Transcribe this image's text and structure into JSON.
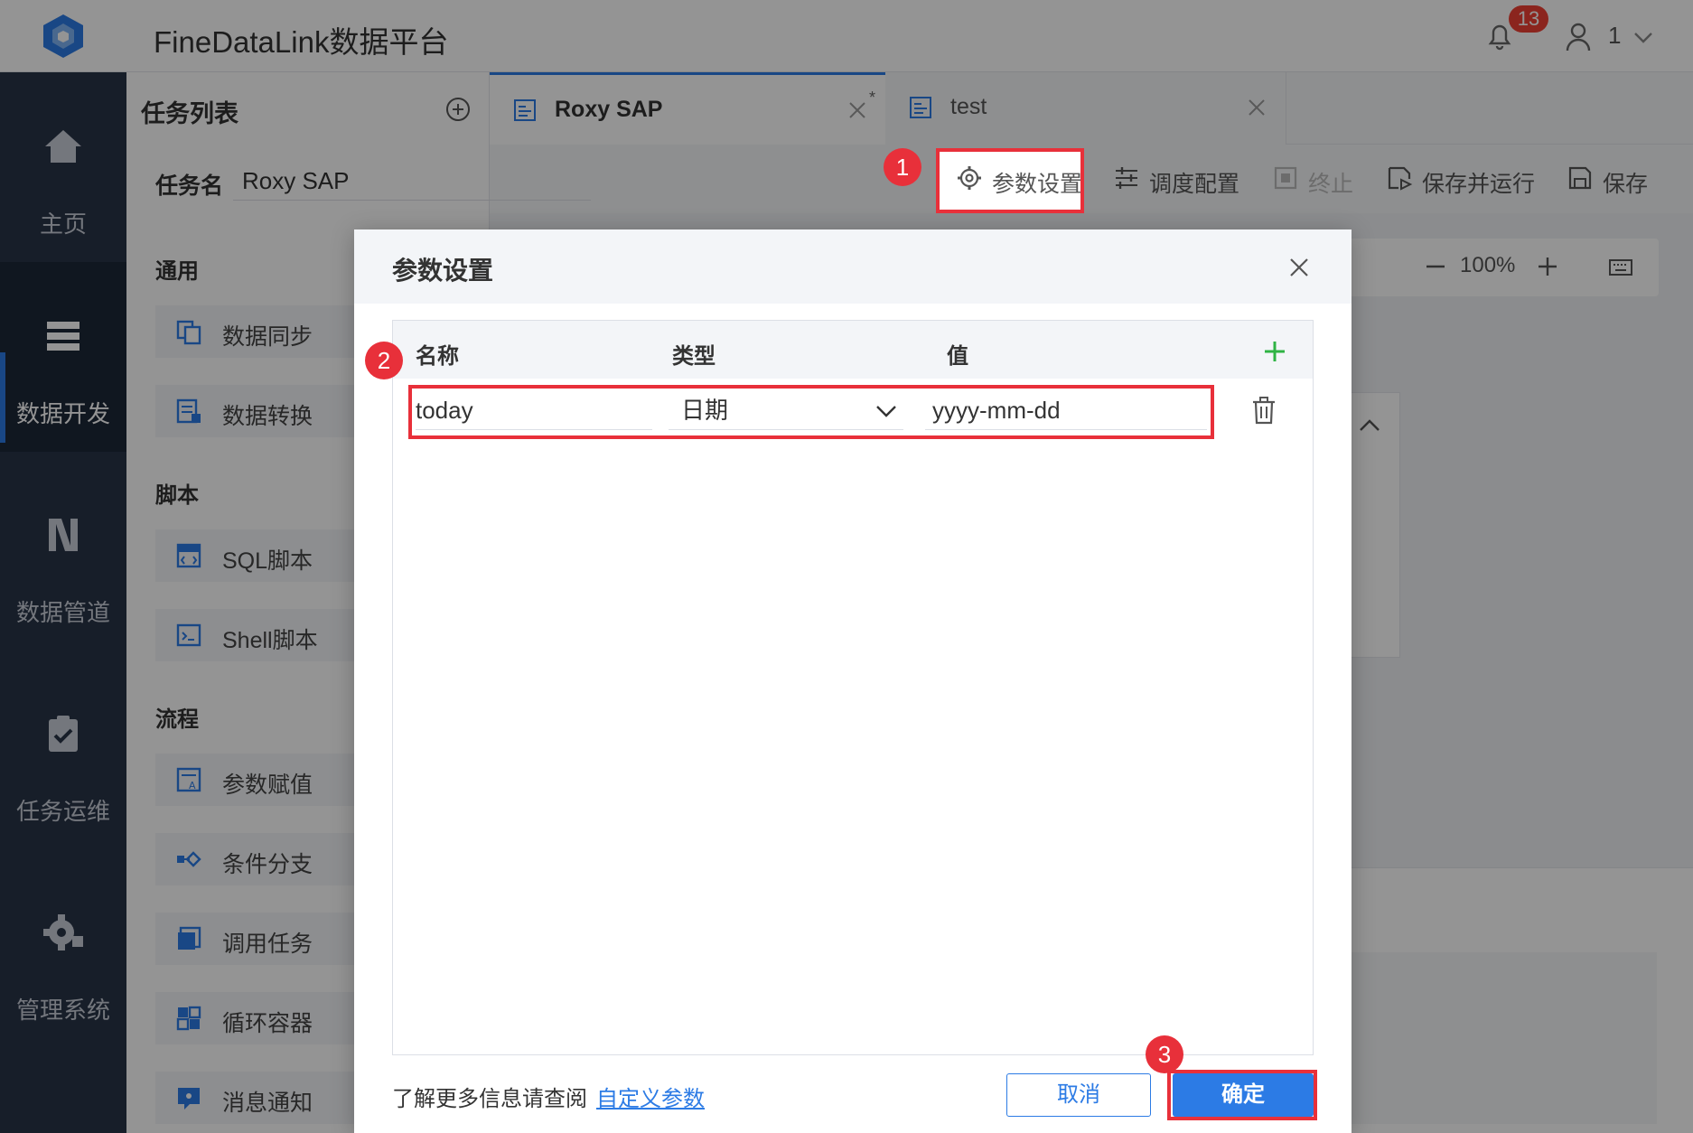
{
  "app": {
    "title": "FineDataLink数据平台",
    "notification_count": "13",
    "user_name": "1"
  },
  "sidebar": {
    "items": [
      {
        "label": "主页",
        "icon": "home-icon"
      },
      {
        "label": "数据开发",
        "icon": "data-dev-icon"
      },
      {
        "label": "数据管道",
        "icon": "pipeline-icon"
      },
      {
        "label": "任务运维",
        "icon": "task-ops-icon"
      },
      {
        "label": "管理系统",
        "icon": "settings-gear-icon"
      }
    ],
    "active_index": 1
  },
  "task_list": {
    "title": "任务列表",
    "sections": [
      {
        "label": "通用",
        "items": [
          "数据同步",
          "数据转换"
        ]
      },
      {
        "label": "脚本",
        "items": [
          "SQL脚本",
          "Shell脚本"
        ]
      },
      {
        "label": "流程",
        "items": [
          "参数赋值",
          "条件分支",
          "调用任务",
          "循环容器",
          "消息通知"
        ]
      }
    ]
  },
  "tabs": [
    {
      "label": "Roxy SAP",
      "active": true,
      "modified_mark": "*"
    },
    {
      "label": "test",
      "active": false
    }
  ],
  "task": {
    "name_label": "任务名",
    "name_value": "Roxy SAP"
  },
  "toolbar": {
    "param_settings": "参数设置",
    "schedule_config": "调度配置",
    "stop": "终止",
    "save_and_run": "保存并运行",
    "save": "保存"
  },
  "canvas": {
    "zoom": "100%"
  },
  "dialog": {
    "title": "参数设置",
    "columns": {
      "name": "名称",
      "type": "类型",
      "value": "值"
    },
    "rows": [
      {
        "name": "today",
        "type": "日期",
        "value": "yyyy-mm-dd"
      }
    ],
    "footer_text": "了解更多信息请查阅",
    "footer_link": "自定义参数",
    "cancel_label": "取消",
    "ok_label": "确定"
  },
  "annotations": {
    "markers": [
      "1",
      "2",
      "3"
    ],
    "highlight_color": "#e8303a"
  },
  "colors": {
    "accent": "#2c7be5",
    "sidebar": "#283447",
    "add_green": "#2fb344"
  }
}
